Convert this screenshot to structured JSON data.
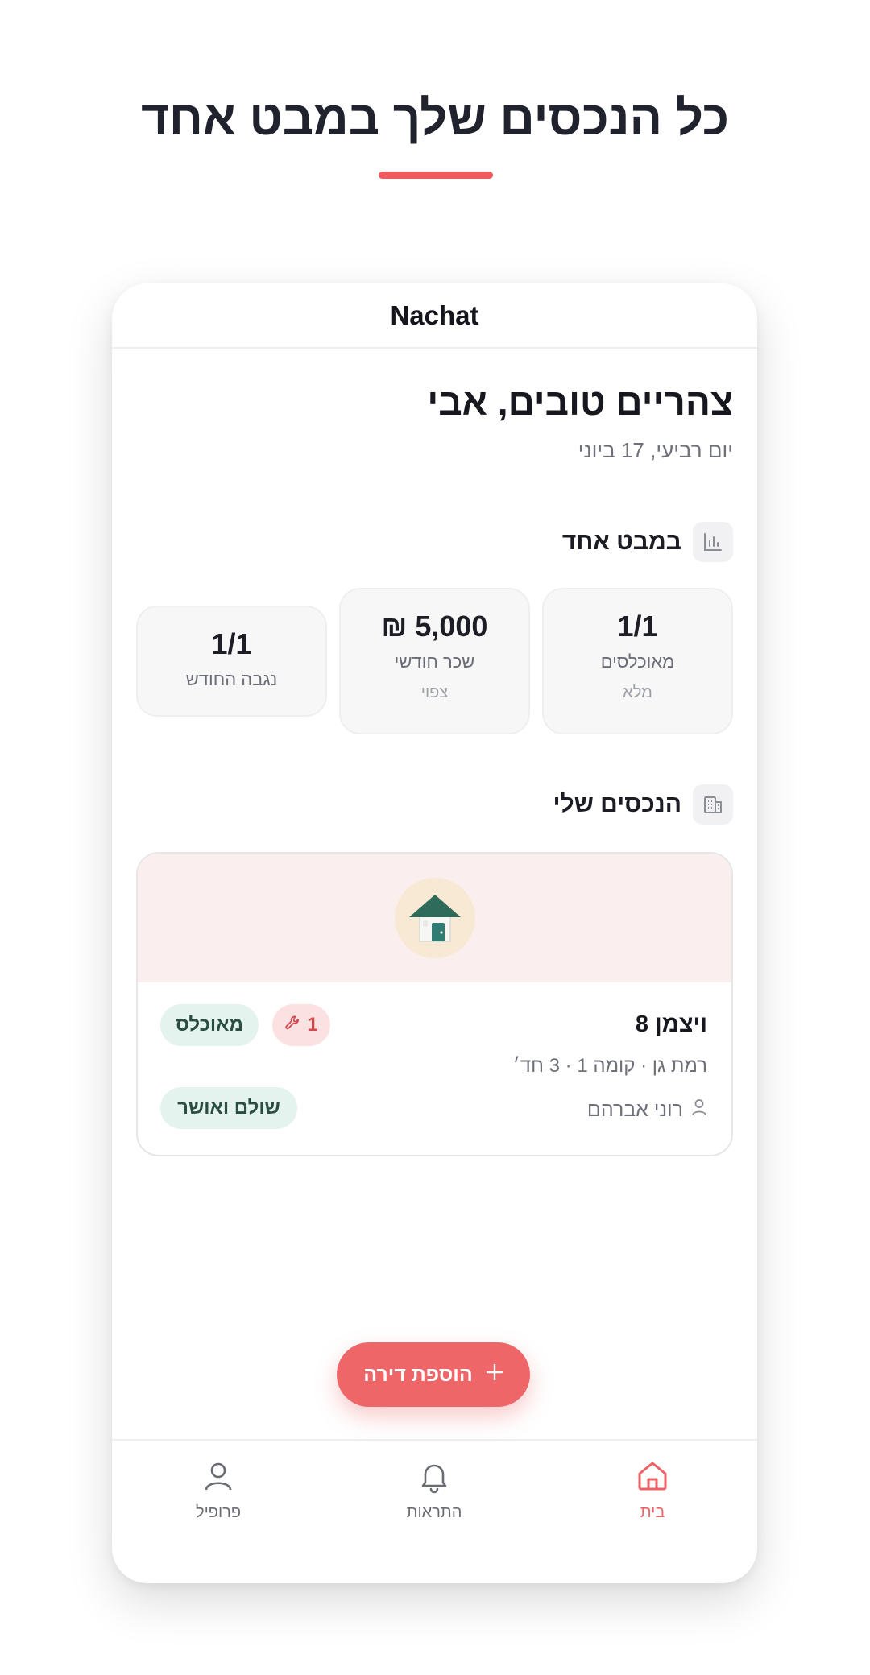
{
  "promo": {
    "title": "כל הנכסים שלך במבט אחד"
  },
  "app": {
    "name": "Nachat"
  },
  "greeting": {
    "title": "צהריים טובים, אבי",
    "date": "יום רביעי, 17 ביוני"
  },
  "overview": {
    "title": "במבט אחד",
    "icon": "bar-chart-icon",
    "stats": [
      {
        "value": "1/1",
        "label": "מאוכלסים",
        "sub": "מלא"
      },
      {
        "value": "5,000 ₪",
        "label": "שכר חודשי",
        "sub": "צפוי"
      },
      {
        "value": "1/1",
        "label": "נגבה החודש",
        "sub": ""
      }
    ]
  },
  "properties": {
    "title": "הנכסים שלי",
    "icon": "building-icon",
    "items": [
      {
        "name": "ויצמן 8",
        "meta": "רמת גן · קומה 1 · 3 חד׳",
        "tenant": "רוני אברהם",
        "status": "מאוכלס",
        "issues_count": "1",
        "payment": "שולם ואושר"
      }
    ]
  },
  "actions": {
    "add_label": "הוספת דירה"
  },
  "nav": {
    "items": [
      {
        "label": "בית",
        "icon": "home-icon",
        "active": true
      },
      {
        "label": "התראות",
        "icon": "bell-icon",
        "active": false
      },
      {
        "label": "פרופיל",
        "icon": "user-icon",
        "active": false
      }
    ]
  },
  "colors": {
    "accent": "#ee6668",
    "green_pill": "#e5f3ee",
    "banner": "#fbeeee"
  }
}
